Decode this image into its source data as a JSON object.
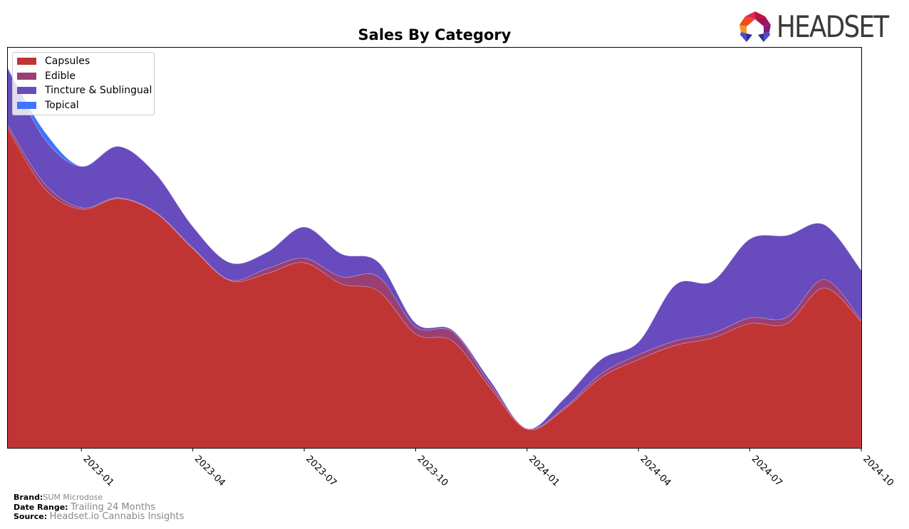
{
  "logo": {
    "text": "HEADSET"
  },
  "footer": {
    "brand_label": "Brand:",
    "brand_value": "SUM Microdose",
    "date_range_label": "Date Range:",
    "date_range_value": "Trailing 24 Months",
    "source_label": "Source:",
    "source_value": "Headset.io Cannabis Insights"
  },
  "chart_data": {
    "type": "area",
    "stacked": true,
    "smoothed": true,
    "title": "Sales By Category",
    "xlabel": "",
    "ylabel": "",
    "y_ticks_visible": false,
    "grid": false,
    "legend_position": "top-left",
    "x_ticks": [
      "2023-01",
      "2023-04",
      "2023-07",
      "2023-10",
      "2024-01",
      "2024-04",
      "2024-07",
      "2024-10"
    ],
    "x": [
      "2022-11",
      "2022-12",
      "2023-01",
      "2023-02",
      "2023-03",
      "2023-04",
      "2023-05",
      "2023-06",
      "2023-07",
      "2023-08",
      "2023-09",
      "2023-10",
      "2023-11",
      "2023-12",
      "2024-01",
      "2024-02",
      "2024-03",
      "2024-04",
      "2024-05",
      "2024-06",
      "2024-07",
      "2024-08",
      "2024-09",
      "2024-10"
    ],
    "ylim": [
      0,
      100
    ],
    "series": [
      {
        "name": "Capsules",
        "color": "#c13434",
        "values": [
          79.9,
          64.8,
          59.5,
          62.2,
          58.6,
          49.7,
          41.7,
          43.5,
          46.2,
          40.9,
          39.1,
          28.4,
          26.6,
          15.1,
          4.6,
          9.6,
          17.6,
          22.0,
          25.6,
          27.4,
          31.0,
          31.0,
          39.9,
          31.5
        ]
      },
      {
        "name": "Edible",
        "color": "#9a3f74",
        "values": [
          0.9,
          1.2,
          0.4,
          0.2,
          0.2,
          0.2,
          0.2,
          1.2,
          1.1,
          1.8,
          3.6,
          1.8,
          2.3,
          0.9,
          0.2,
          0.4,
          0.9,
          1.2,
          1.1,
          1.2,
          1.4,
          1.6,
          2.1,
          0.4
        ]
      },
      {
        "name": "Tincture & Sublingual",
        "color": "#684cbd",
        "values": [
          14.2,
          11.2,
          10.3,
          12.8,
          9.6,
          5.3,
          4.3,
          4.1,
          7.8,
          5.7,
          3.6,
          0.9,
          0.4,
          0.9,
          0.0,
          2.3,
          3.6,
          3.2,
          14.0,
          13.0,
          19.7,
          20.4,
          13.7,
          12.4
        ]
      },
      {
        "name": "Topical",
        "color": "#3f72ff",
        "values": [
          0.0,
          1.8,
          0.0,
          0.0,
          0.0,
          0.0,
          0.0,
          0.0,
          0.0,
          0.0,
          0.0,
          0.0,
          0.0,
          0.0,
          0.0,
          0.0,
          0.0,
          0.0,
          0.0,
          0.0,
          0.0,
          0.0,
          0.0,
          0.0
        ]
      }
    ]
  }
}
